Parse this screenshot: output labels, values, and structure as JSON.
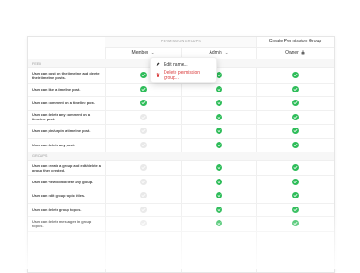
{
  "header": {
    "permission_groups_label": "PERMISSION GROUPS",
    "create_button": "Create Permission Group"
  },
  "columns": [
    {
      "label": "Member",
      "chevron": "⌄"
    },
    {
      "label": "Admin",
      "chevron": "⌄"
    },
    {
      "label": "Owner",
      "lock": "🔒"
    }
  ],
  "menu": {
    "edit_label": "Edit name...",
    "delete_label": "Delete permission group..."
  },
  "sections": [
    {
      "title": "FEED",
      "rows": [
        {
          "label": "User can post on the timeline and delete their timeline posts.",
          "values": [
            true,
            true,
            true
          ]
        },
        {
          "label": "User can like a timeline post.",
          "values": [
            true,
            true,
            true
          ]
        },
        {
          "label": "User can comment on a timeline post.",
          "values": [
            true,
            true,
            true
          ]
        },
        {
          "label": "User can delete any comment on a timeline post.",
          "values": [
            false,
            true,
            true
          ]
        },
        {
          "label": "User can pin/unpin a timeline post.",
          "values": [
            false,
            true,
            true
          ]
        },
        {
          "label": "User can delete any post.",
          "values": [
            false,
            true,
            true
          ]
        }
      ]
    },
    {
      "title": "GROUPS",
      "rows": [
        {
          "label": "User can create a group and edit/delete a group they created.",
          "values": [
            false,
            true,
            true
          ]
        },
        {
          "label": "User can view/edit/delete any group.",
          "values": [
            false,
            true,
            true
          ]
        },
        {
          "label": "User can edit group topic titles.",
          "values": [
            false,
            true,
            true
          ]
        },
        {
          "label": "User can delete group topics.",
          "values": [
            false,
            true,
            true
          ]
        },
        {
          "label": "User can delete messages in group topics.",
          "values": [
            false,
            true,
            true
          ]
        }
      ]
    }
  ]
}
